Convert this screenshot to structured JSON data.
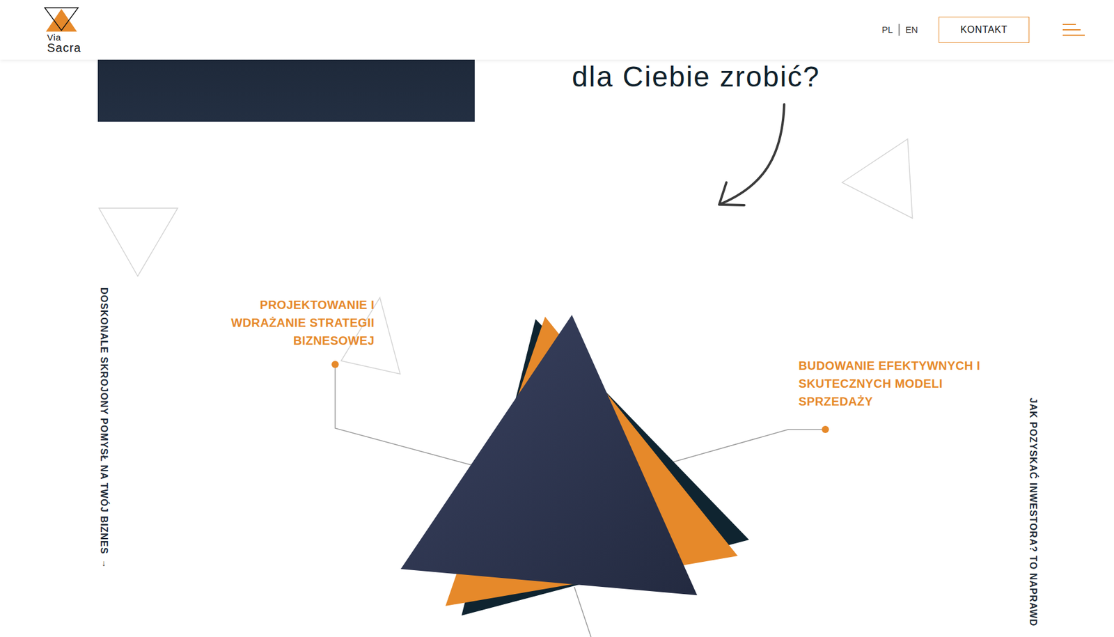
{
  "header": {
    "logo": {
      "line1": "Via",
      "line2": "Sacra"
    },
    "languages": [
      {
        "label": "PL"
      },
      {
        "label": "EN"
      }
    ],
    "contact_button": "KONTAKT"
  },
  "heading": "dla Ciebie zrobić?",
  "side_texts": {
    "left": "DOSKONALE SKROJONY POMYSŁ NA TWÓJ BIZNES",
    "left_arrow": "↓",
    "right": "JAK POZYSKAĆ INWESTORA? TO NAPRAWD"
  },
  "services": [
    {
      "lines": [
        "PROJEKTOWANIE I",
        "WDRAŻANIE STRATEGII",
        "BIZNESOWEJ"
      ],
      "align": "right"
    },
    {
      "lines": [
        "BUDOWANIE EFEKTYWNYCH I",
        "SKUTECZNYCH MODELI",
        "SPRZEDAŻY"
      ],
      "align": "left"
    }
  ]
}
